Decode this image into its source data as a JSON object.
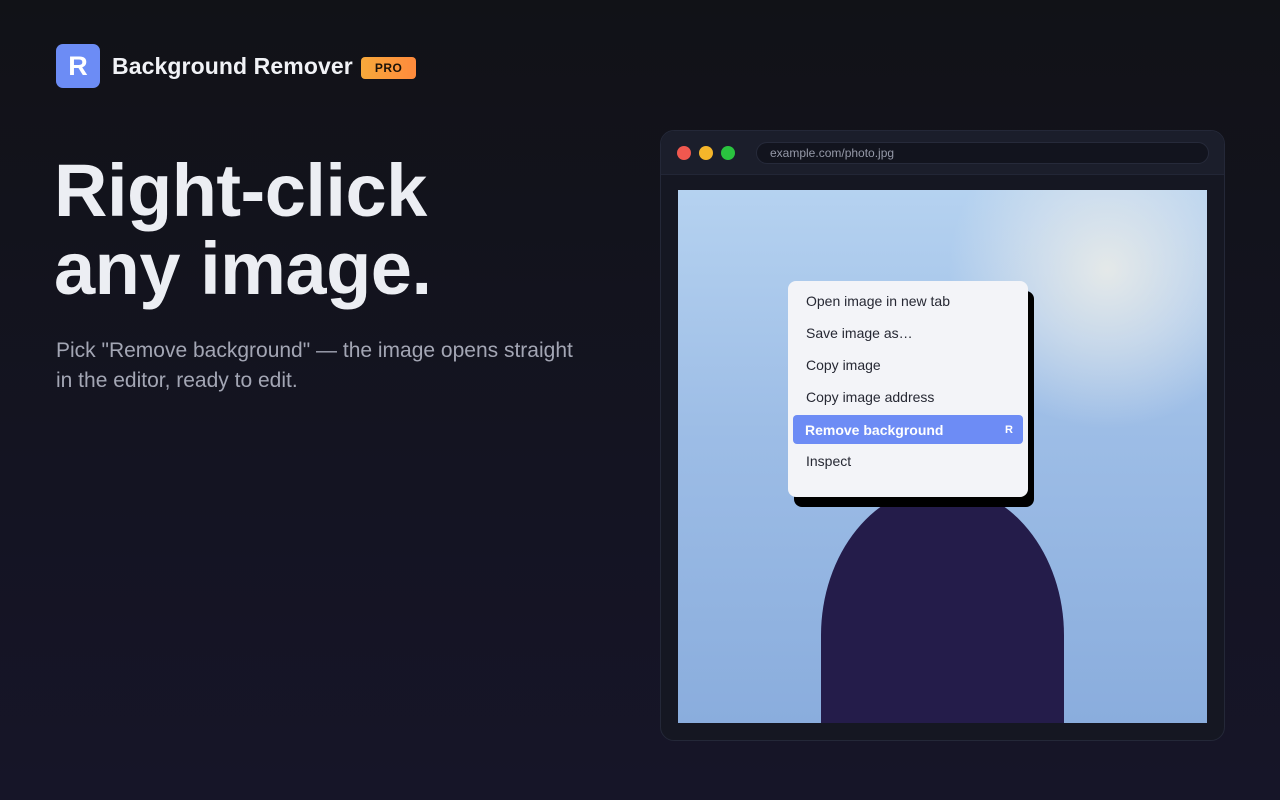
{
  "brand": {
    "logo_letter": "R",
    "name": "Background Remover",
    "badge": "PRO"
  },
  "hero": {
    "headline_line1": "Right-click",
    "headline_line2": "any image.",
    "subtitle": "Pick \"Remove background\" — the image opens straight in the editor, ready to edit."
  },
  "browser": {
    "url": "example.com/photo.jpg"
  },
  "context_menu": {
    "items": [
      {
        "label": "Open image in new tab"
      },
      {
        "label": "Save image as…"
      },
      {
        "label": "Copy image"
      },
      {
        "label": "Copy image address"
      },
      {
        "label": "Remove background",
        "shortcut": "R",
        "highlighted": true
      },
      {
        "label": "Inspect"
      }
    ]
  },
  "colors": {
    "accent": "#6d8cf5",
    "badge": "#f7a93b",
    "background": "#111217"
  }
}
